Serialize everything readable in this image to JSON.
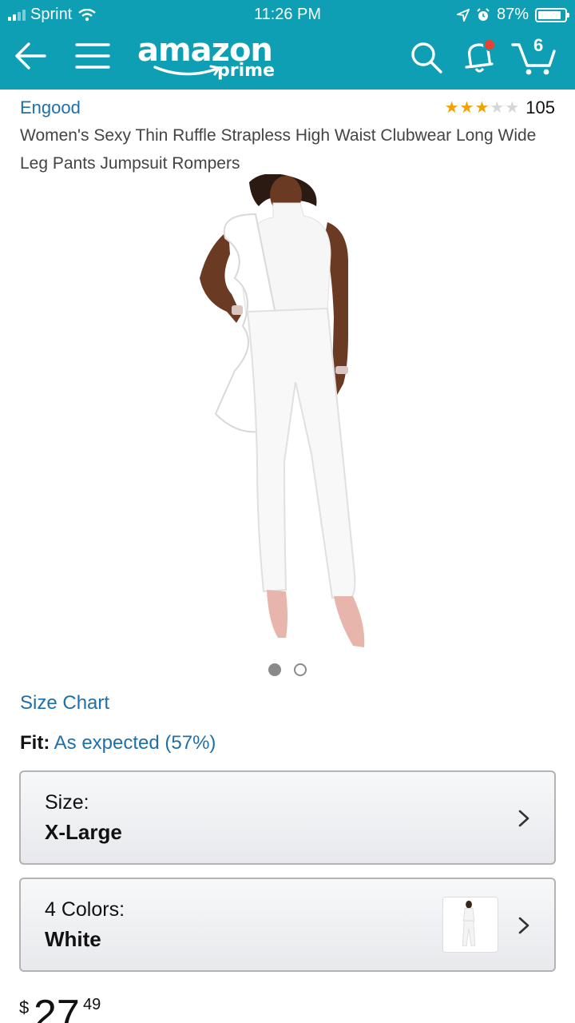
{
  "status_bar": {
    "carrier": "Sprint",
    "time": "11:26 PM",
    "battery": "87%",
    "battery_level": 0.87
  },
  "nav": {
    "logo_word": "amazon",
    "logo_sub": "prime",
    "cart_count": "6",
    "icons": [
      "back-arrow-icon",
      "menu-icon",
      "search-icon",
      "notification-bell-icon",
      "cart-icon"
    ]
  },
  "product": {
    "brand": "Engood",
    "rating_stars": 3,
    "rating_max": 5,
    "review_count": "105",
    "title": "Women's Sexy Thin Ruffle Strapless High Waist Clubwear Long Wide Leg Pants Jumpsuit Rompers"
  },
  "gallery": {
    "image_count": 2,
    "active_index": 0
  },
  "links": {
    "size_chart": "Size Chart"
  },
  "fit": {
    "label": "Fit:",
    "value": "As expected (57%)"
  },
  "size_selector": {
    "label": "Size:",
    "value": "X-Large"
  },
  "color_selector": {
    "label": "4 Colors:",
    "value": "White"
  },
  "price": {
    "currency": "$",
    "whole": "27",
    "fraction": "49"
  },
  "colors": {
    "header": "#0f9fb4",
    "link": "#1f6fa9",
    "star": "#f2a200"
  }
}
